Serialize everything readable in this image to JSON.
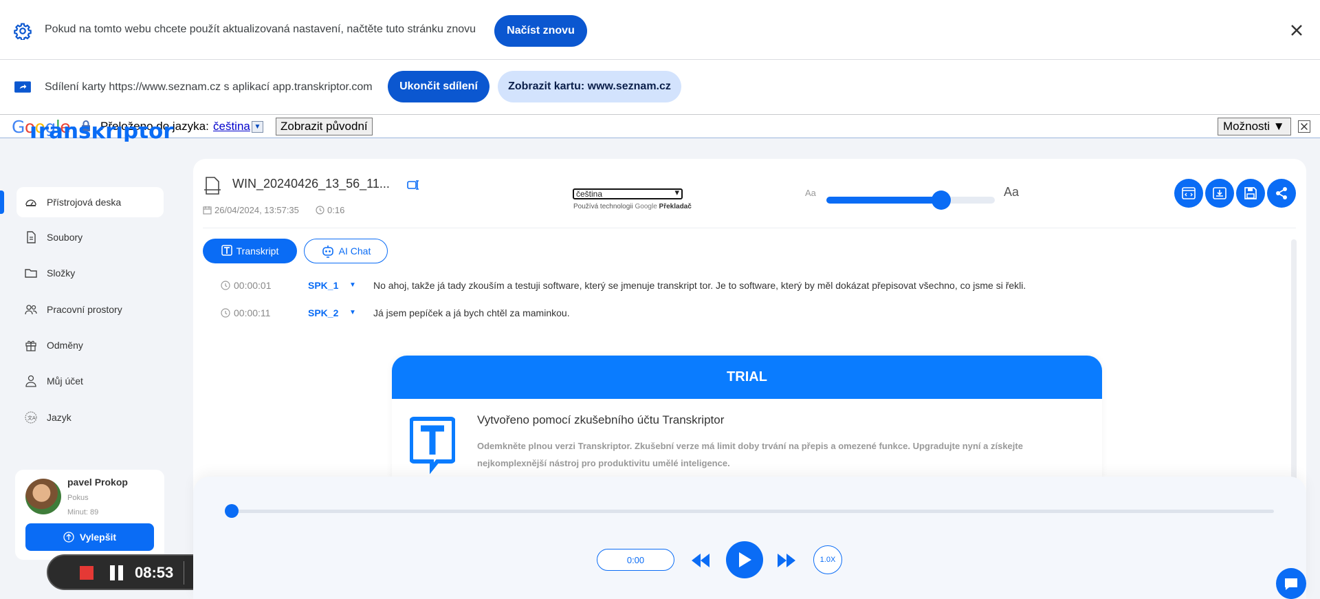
{
  "reload_bar": {
    "message": "Pokud na tomto webu chcete použít aktualizovaná nastavení, načtěte tuto stránku znovu",
    "button": "Načíst znovu"
  },
  "share_bar": {
    "message": "Sdílení karty https://www.seznam.cz s aplikací app.transkriptor.com",
    "stop_button": "Ukončit sdílení",
    "show_button": "Zobrazit kartu: www.seznam.cz"
  },
  "translate_bar": {
    "logo": "Google",
    "label": "Přeloženo do jazyka:",
    "language": "čeština",
    "show_original": "Zobrazit původní",
    "options": "Možnosti ▼"
  },
  "sidebar": {
    "logo": "Transkriptor",
    "items": [
      {
        "label": "Přístrojová deska",
        "icon": "dashboard-icon"
      },
      {
        "label": "Soubory",
        "icon": "file-icon"
      },
      {
        "label": "Složky",
        "icon": "folder-icon"
      },
      {
        "label": "Pracovní prostory",
        "icon": "users-icon"
      },
      {
        "label": "Odměny",
        "icon": "gift-icon"
      },
      {
        "label": "Můj účet",
        "icon": "user-icon"
      },
      {
        "label": "Jazyk",
        "icon": "language-icon"
      }
    ],
    "user": {
      "name": "pavel Prokop",
      "plan": "Pokus",
      "minutes": "Minut: 89",
      "upgrade": "Vylepšit"
    }
  },
  "recorder": {
    "time": "08:53",
    "colors": {
      "stop": "#e53935"
    }
  },
  "file": {
    "name": "WIN_20240426_13_56_11...",
    "date": "26/04/2024, 13:57:35",
    "duration": "0:16",
    "language_select": "čeština",
    "powered_by_prefix": "Používá technologii",
    "powered_by_brand": "Google",
    "powered_by_suffix": "Překladač",
    "font_size_small": "Aa",
    "font_size_large": "Aa",
    "font_size_level": 0.68
  },
  "tabs": {
    "transcript": "Transkript",
    "ai_chat": "AI Chat"
  },
  "transcript": [
    {
      "time": "00:00:01",
      "speaker": "SPK_1",
      "text": "No ahoj, takže já tady zkouším a testuji software, který se jmenuje transkript tor. Je to software, který by měl dokázat přepisovat všechno, co jsme si řekli."
    },
    {
      "time": "00:00:11",
      "speaker": "SPK_2",
      "text": "Já jsem pepíček a já bych chtěl za maminkou."
    }
  ],
  "trial": {
    "header": "TRIAL",
    "title": "Vytvořeno pomocí zkušebního účtu Transkriptor",
    "description": "Odemkněte plnou verzi Transkriptor. Zkušební verze má limit doby trvání na přepis a omezené funkce. Upgradujte nyní a získejte nejkomplexnější nástroj pro produktivitu umělé inteligence."
  },
  "player": {
    "current_time": "0:00",
    "speed": "1.0X",
    "progress": 0.0
  },
  "colors": {
    "accent": "#0a6cf5",
    "chrome_blue": "#0b57d0",
    "chrome_light": "#d3e3fd"
  }
}
